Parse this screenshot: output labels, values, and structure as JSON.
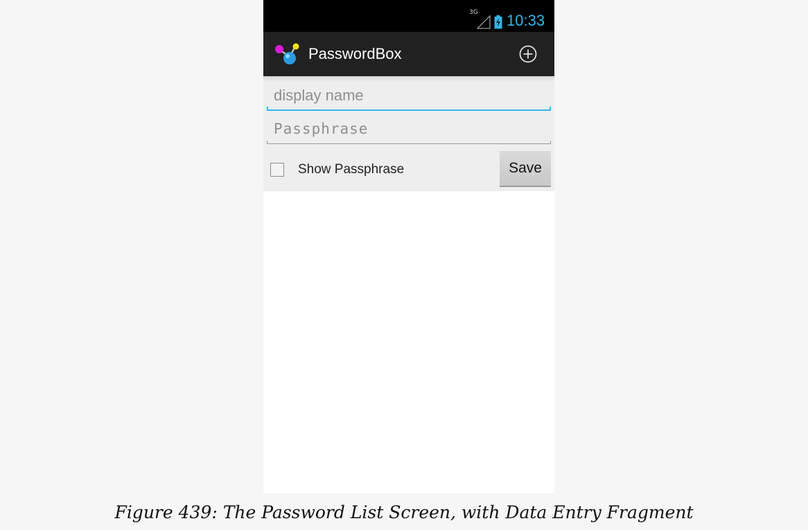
{
  "status_bar": {
    "network": "3G",
    "time": "10:33",
    "icons": [
      "signal-icon",
      "battery-charging-icon"
    ]
  },
  "action_bar": {
    "title": "PasswordBox",
    "icons": [
      "app-logo-icon",
      "add-icon"
    ]
  },
  "form": {
    "display_name": {
      "value": "",
      "placeholder": "display name"
    },
    "passphrase": {
      "value": "",
      "placeholder": "Passphrase"
    },
    "show_passphrase": {
      "label": "Show Passphrase",
      "checked": false
    },
    "save_label": "Save"
  },
  "colors": {
    "accent": "#33b5e5",
    "action_bar": "#212121",
    "status_bar": "#000000",
    "form_background": "#eeeeee"
  },
  "caption": "Figure 439: The Password List Screen, with Data Entry Fragment"
}
